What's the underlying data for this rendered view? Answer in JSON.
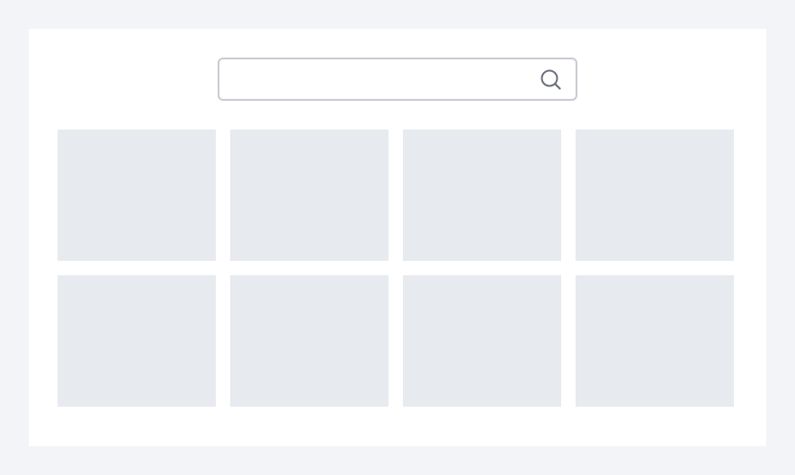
{
  "search": {
    "value": "",
    "placeholder": "",
    "icon": "search-icon",
    "border_color": "#c9cad4",
    "icon_color": "#6b6e7c"
  },
  "grid": {
    "tile_count": 8,
    "tile_color": "#e7eaef"
  },
  "colors": {
    "background": "#f3f4f8",
    "panel": "#ffffff"
  }
}
